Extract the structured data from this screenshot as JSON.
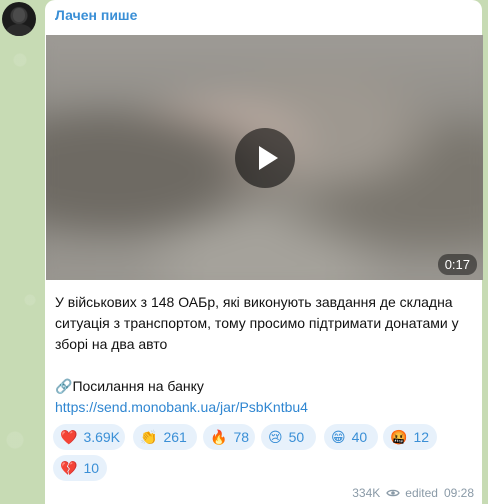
{
  "channel": {
    "author": "Лачен пише"
  },
  "video": {
    "duration": "0:17"
  },
  "message": {
    "text": "У військових з 148 ОАБр, які виконують завдання де складна ситуація з транспортом, тому просимо підтримати донатами у зборі на два авто",
    "link_prefix_icon": "🔗",
    "link_label": "Посилання на банку",
    "url": "https://send.monobank.ua/jar/PsbKntbu4"
  },
  "reactions": [
    {
      "emoji": "❤️",
      "name": "heart-icon",
      "count": "3.69K"
    },
    {
      "emoji": "👏",
      "name": "clap-icon",
      "count": "261"
    },
    {
      "emoji": "🔥",
      "name": "fire-icon",
      "count": "78"
    },
    {
      "emoji": "😢",
      "name": "cry-icon",
      "count": "50"
    },
    {
      "emoji": "😁",
      "name": "grin-icon",
      "count": "40"
    },
    {
      "emoji": "🤬",
      "name": "angry-icon",
      "count": "12"
    },
    {
      "emoji": "💔",
      "name": "broken-heart-icon",
      "count": "10"
    }
  ],
  "meta": {
    "views": "334K",
    "edited_label": "edited",
    "time": "09:28"
  },
  "colors": {
    "accent": "#3a8fd6",
    "link": "#2f86d1",
    "reaction_bg": "#e7f1fb",
    "wallpaper": "#c7dbb4"
  }
}
